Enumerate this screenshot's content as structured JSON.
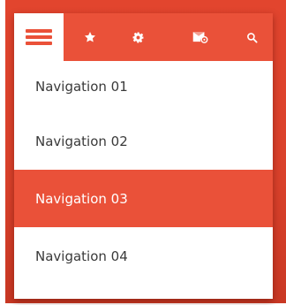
{
  "toolbar": {
    "icons": [
      "menu-icon",
      "star-icon",
      "gear-icon",
      "mail-settings-icon",
      "search-icon"
    ]
  },
  "nav": {
    "items": [
      {
        "label": "Navigation 01",
        "active": false
      },
      {
        "label": "Navigation 02",
        "active": false
      },
      {
        "label": "Navigation 03",
        "active": true
      },
      {
        "label": "Navigation 04",
        "active": false
      }
    ]
  },
  "colors": {
    "accent": "#ea5139",
    "backdrop": "#d9412b",
    "text": "#3a3a3a",
    "active_text": "#ffffff",
    "surface": "#ffffff"
  }
}
